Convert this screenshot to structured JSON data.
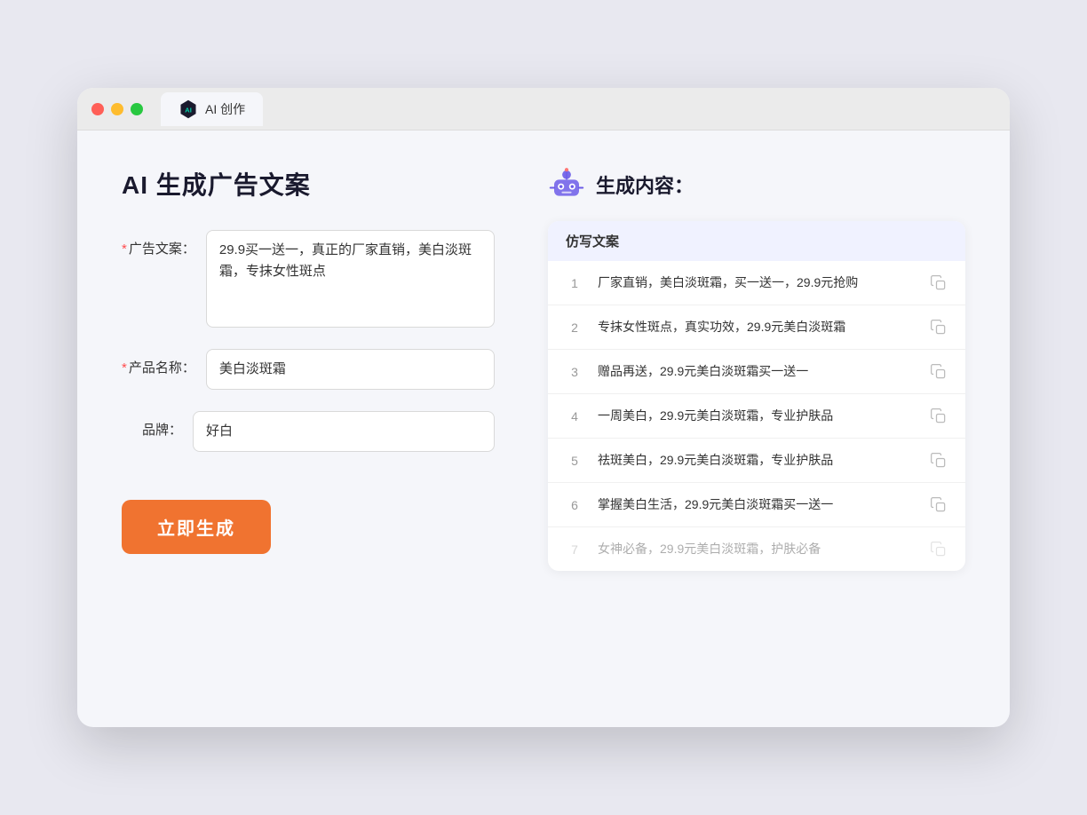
{
  "tab": {
    "label": "AI 创作"
  },
  "left": {
    "title": "AI 生成广告文案",
    "fields": [
      {
        "label": "广告文案：",
        "required": true,
        "type": "textarea",
        "value": "29.9买一送一，真正的厂家直销，美白淡斑霜，专抹女性斑点",
        "placeholder": ""
      },
      {
        "label": "产品名称：",
        "required": true,
        "type": "input",
        "value": "美白淡斑霜",
        "placeholder": ""
      },
      {
        "label": "品牌：",
        "required": false,
        "type": "input",
        "value": "好白",
        "placeholder": ""
      }
    ],
    "button": "立即生成"
  },
  "right": {
    "title": "生成内容：",
    "table_header": "仿写文案",
    "rows": [
      {
        "num": "1",
        "text": "厂家直销，美白淡斑霜，买一送一，29.9元抢购",
        "faded": false
      },
      {
        "num": "2",
        "text": "专抹女性斑点，真实功效，29.9元美白淡斑霜",
        "faded": false
      },
      {
        "num": "3",
        "text": "赠品再送，29.9元美白淡斑霜买一送一",
        "faded": false
      },
      {
        "num": "4",
        "text": "一周美白，29.9元美白淡斑霜，专业护肤品",
        "faded": false
      },
      {
        "num": "5",
        "text": "祛斑美白，29.9元美白淡斑霜，专业护肤品",
        "faded": false
      },
      {
        "num": "6",
        "text": "掌握美白生活，29.9元美白淡斑霜买一送一",
        "faded": false
      },
      {
        "num": "7",
        "text": "女神必备，29.9元美白淡斑霜，护肤必备",
        "faded": true
      }
    ]
  }
}
